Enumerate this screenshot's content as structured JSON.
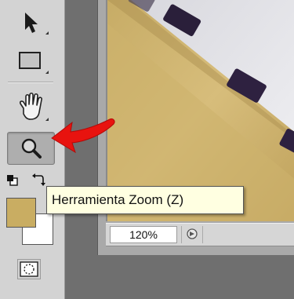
{
  "toolbar": {
    "tools": [
      {
        "name": "move-tool",
        "icon": "arrow-cursor-icon"
      },
      {
        "name": "rectangular-marquee-tool",
        "icon": "rectangle-icon"
      },
      {
        "name": "hand-tool",
        "icon": "hand-icon"
      },
      {
        "name": "zoom-tool",
        "icon": "magnifier-icon",
        "active": true
      }
    ],
    "colors": {
      "foreground": "#c9ad62",
      "background": "#ffffff"
    }
  },
  "tooltip": {
    "text": "Herramienta Zoom (Z)"
  },
  "document": {
    "zoom_level": "120%"
  },
  "annotation": {
    "arrow_color": "#e8130f",
    "arrow_icon": "red-arrow-icon"
  }
}
